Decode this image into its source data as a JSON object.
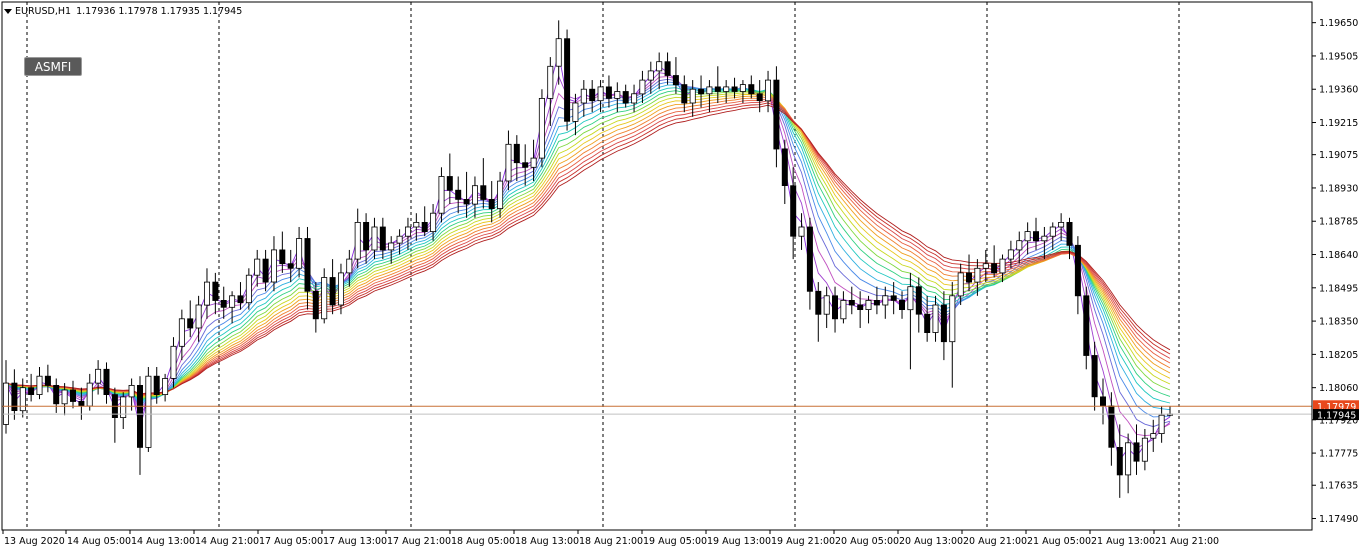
{
  "header": {
    "symbol": "EURUSD,H1",
    "ohlc": [
      "1.17936",
      "1.17978",
      "1.17935",
      "1.17945"
    ]
  },
  "badge": {
    "label": "ASMFI"
  },
  "colors": {
    "bull_body": "#ffffff",
    "bear_body": "#000000",
    "candle_outline": "#000000",
    "grid": "#000000",
    "bid_line": "#c87137",
    "bid_label_bg": "#e8481c",
    "current_label_bg": "#000000",
    "ribbon": [
      "#8a2be2",
      "#a040d0",
      "#c050c0",
      "#6a6ad8",
      "#4a8ae8",
      "#30b0e0",
      "#20c8c0",
      "#30d080",
      "#80d840",
      "#c8d820",
      "#e8c820",
      "#f0a020",
      "#f08030",
      "#e86040",
      "#d84848",
      "#c8302a",
      "#b02020"
    ]
  },
  "chart_data": {
    "type": "candlestick",
    "symbol": "EURUSD",
    "timeframe": "H1",
    "indicator": "ASMFI",
    "y_axis": {
      "ticks": [
        "1.19650",
        "1.19505",
        "1.19360",
        "1.19215",
        "1.19075",
        "1.18930",
        "1.18785",
        "1.18640",
        "1.18495",
        "1.18350",
        "1.18205",
        "1.18060",
        "1.17920",
        "1.17775",
        "1.17635",
        "1.17490"
      ],
      "ylim": [
        1.1744,
        1.1974
      ]
    },
    "x_axis": {
      "ticks": [
        "13 Aug 2020",
        "14 Aug 05:00",
        "14 Aug 13:00",
        "14 Aug 21:00",
        "17 Aug 05:00",
        "17 Aug 13:00",
        "17 Aug 21:00",
        "18 Aug 05:00",
        "18 Aug 13:00",
        "18 Aug 21:00",
        "19 Aug 05:00",
        "19 Aug 13:00",
        "19 Aug 21:00",
        "20 Aug 05:00",
        "20 Aug 13:00",
        "20 Aug 21:00",
        "21 Aug 05:00",
        "21 Aug 13:00",
        "21 Aug 21:00"
      ],
      "period_separators": 7
    },
    "price_labels": {
      "bid": "1.17979",
      "current": "1.17945"
    },
    "bid_price": 1.17979,
    "current_price": 1.17945,
    "candles_ohlc": [
      [
        1.179,
        1.1818,
        1.1786,
        1.1808
      ],
      [
        1.1808,
        1.1814,
        1.1792,
        1.1796
      ],
      [
        1.1796,
        1.181,
        1.1793,
        1.1806
      ],
      [
        1.1806,
        1.1812,
        1.18,
        1.1803
      ],
      [
        1.1803,
        1.1815,
        1.1801,
        1.1811
      ],
      [
        1.1811,
        1.1816,
        1.1804,
        1.1807
      ],
      [
        1.1807,
        1.181,
        1.1795,
        1.1799
      ],
      [
        1.1799,
        1.1808,
        1.1794,
        1.1805
      ],
      [
        1.1805,
        1.1809,
        1.1797,
        1.18
      ],
      [
        1.18,
        1.1806,
        1.1792,
        1.1798
      ],
      [
        1.1798,
        1.1812,
        1.1796,
        1.1808
      ],
      [
        1.1808,
        1.1818,
        1.1803,
        1.1814
      ],
      [
        1.1814,
        1.1817,
        1.1799,
        1.1803
      ],
      [
        1.1803,
        1.1806,
        1.1782,
        1.1793
      ],
      [
        1.1793,
        1.1804,
        1.1788,
        1.1802
      ],
      [
        1.1802,
        1.181,
        1.1796,
        1.1807
      ],
      [
        1.1807,
        1.1811,
        1.1768,
        1.178
      ],
      [
        1.178,
        1.1815,
        1.1778,
        1.1811
      ],
      [
        1.1811,
        1.1815,
        1.1799,
        1.1803
      ],
      [
        1.1803,
        1.1812,
        1.18,
        1.181
      ],
      [
        1.181,
        1.1828,
        1.1806,
        1.1824
      ],
      [
        1.1824,
        1.184,
        1.1818,
        1.1836
      ],
      [
        1.1836,
        1.1844,
        1.1828,
        1.1832
      ],
      [
        1.1832,
        1.1846,
        1.1826,
        1.1842
      ],
      [
        1.1842,
        1.1858,
        1.1836,
        1.1852
      ],
      [
        1.1852,
        1.1856,
        1.1838,
        1.1844
      ],
      [
        1.1844,
        1.185,
        1.1836,
        1.1841
      ],
      [
        1.1841,
        1.1848,
        1.1834,
        1.1846
      ],
      [
        1.1846,
        1.1852,
        1.184,
        1.1843
      ],
      [
        1.1843,
        1.1858,
        1.184,
        1.1855
      ],
      [
        1.1855,
        1.1866,
        1.185,
        1.1862
      ],
      [
        1.1862,
        1.1866,
        1.1848,
        1.1852
      ],
      [
        1.1852,
        1.1872,
        1.1848,
        1.1866
      ],
      [
        1.1866,
        1.1874,
        1.1856,
        1.186
      ],
      [
        1.186,
        1.1866,
        1.1852,
        1.1858
      ],
      [
        1.1858,
        1.1876,
        1.1854,
        1.1871
      ],
      [
        1.1871,
        1.1876,
        1.184,
        1.1848
      ],
      [
        1.1848,
        1.1852,
        1.183,
        1.1836
      ],
      [
        1.1836,
        1.1858,
        1.1834,
        1.1854
      ],
      [
        1.1854,
        1.1862,
        1.1838,
        1.1842
      ],
      [
        1.1842,
        1.186,
        1.1838,
        1.1856
      ],
      [
        1.1856,
        1.1866,
        1.185,
        1.1862
      ],
      [
        1.1862,
        1.1884,
        1.1858,
        1.1878
      ],
      [
        1.1878,
        1.1882,
        1.186,
        1.1866
      ],
      [
        1.1866,
        1.188,
        1.1862,
        1.1876
      ],
      [
        1.1876,
        1.188,
        1.1862,
        1.1866
      ],
      [
        1.1866,
        1.1872,
        1.186,
        1.1869
      ],
      [
        1.1869,
        1.1875,
        1.1864,
        1.1872
      ],
      [
        1.1872,
        1.188,
        1.1866,
        1.1876
      ],
      [
        1.1876,
        1.1882,
        1.187,
        1.1878
      ],
      [
        1.1878,
        1.1885,
        1.1872,
        1.1874
      ],
      [
        1.1874,
        1.1886,
        1.187,
        1.1882
      ],
      [
        1.1882,
        1.1902,
        1.1878,
        1.1898
      ],
      [
        1.1898,
        1.1908,
        1.1886,
        1.1892
      ],
      [
        1.1892,
        1.1898,
        1.1882,
        1.1888
      ],
      [
        1.1888,
        1.19,
        1.188,
        1.1886
      ],
      [
        1.1886,
        1.1898,
        1.188,
        1.1894
      ],
      [
        1.1894,
        1.1906,
        1.1884,
        1.1888
      ],
      [
        1.1888,
        1.1896,
        1.1878,
        1.1884
      ],
      [
        1.1884,
        1.19,
        1.188,
        1.1896
      ],
      [
        1.1896,
        1.1918,
        1.1892,
        1.1912
      ],
      [
        1.1912,
        1.1916,
        1.1896,
        1.1904
      ],
      [
        1.1904,
        1.1912,
        1.1894,
        1.1902
      ],
      [
        1.1902,
        1.1914,
        1.1896,
        1.1906
      ],
      [
        1.1906,
        1.1936,
        1.1902,
        1.1932
      ],
      [
        1.1932,
        1.195,
        1.192,
        1.1946
      ],
      [
        1.1946,
        1.1966,
        1.1938,
        1.1958
      ],
      [
        1.1958,
        1.1962,
        1.1918,
        1.1922
      ],
      [
        1.1922,
        1.1934,
        1.1916,
        1.193
      ],
      [
        1.193,
        1.194,
        1.1924,
        1.1936
      ],
      [
        1.1936,
        1.194,
        1.1926,
        1.1931
      ],
      [
        1.1931,
        1.194,
        1.1926,
        1.1937
      ],
      [
        1.1937,
        1.1942,
        1.1928,
        1.1932
      ],
      [
        1.1932,
        1.1939,
        1.1926,
        1.1935
      ],
      [
        1.1935,
        1.1938,
        1.1928,
        1.193
      ],
      [
        1.193,
        1.1938,
        1.1926,
        1.1934
      ],
      [
        1.1934,
        1.1944,
        1.193,
        1.194
      ],
      [
        1.194,
        1.1948,
        1.1934,
        1.1944
      ],
      [
        1.1944,
        1.1952,
        1.1936,
        1.1948
      ],
      [
        1.1948,
        1.1952,
        1.1938,
        1.1942
      ],
      [
        1.1942,
        1.195,
        1.1934,
        1.1938
      ],
      [
        1.1938,
        1.1942,
        1.1926,
        1.193
      ],
      [
        1.193,
        1.194,
        1.1924,
        1.1936
      ],
      [
        1.1936,
        1.1942,
        1.1928,
        1.1934
      ],
      [
        1.1934,
        1.194,
        1.1926,
        1.1937
      ],
      [
        1.1937,
        1.1946,
        1.193,
        1.1935
      ],
      [
        1.1935,
        1.194,
        1.193,
        1.1937
      ],
      [
        1.1937,
        1.1941,
        1.1932,
        1.1935
      ],
      [
        1.1935,
        1.194,
        1.193,
        1.1938
      ],
      [
        1.1938,
        1.1942,
        1.1932,
        1.1934
      ],
      [
        1.1934,
        1.194,
        1.1926,
        1.1931
      ],
      [
        1.1931,
        1.1944,
        1.1926,
        1.194
      ],
      [
        1.194,
        1.1946,
        1.1902,
        1.191
      ],
      [
        1.191,
        1.1914,
        1.1886,
        1.1894
      ],
      [
        1.1894,
        1.1902,
        1.1862,
        1.1872
      ],
      [
        1.1872,
        1.1882,
        1.1866,
        1.1876
      ],
      [
        1.1876,
        1.188,
        1.184,
        1.1848
      ],
      [
        1.1848,
        1.1852,
        1.1826,
        1.1838
      ],
      [
        1.1838,
        1.185,
        1.1832,
        1.1846
      ],
      [
        1.1846,
        1.185,
        1.183,
        1.1836
      ],
      [
        1.1836,
        1.1848,
        1.1834,
        1.1844
      ],
      [
        1.1844,
        1.185,
        1.1838,
        1.1842
      ],
      [
        1.1842,
        1.1848,
        1.1832,
        1.184
      ],
      [
        1.184,
        1.1846,
        1.1834,
        1.1844
      ],
      [
        1.1844,
        1.185,
        1.1838,
        1.1842
      ],
      [
        1.1842,
        1.185,
        1.1836,
        1.1846
      ],
      [
        1.1846,
        1.1852,
        1.1838,
        1.1844
      ],
      [
        1.1844,
        1.1848,
        1.1836,
        1.184
      ],
      [
        1.184,
        1.1856,
        1.1814,
        1.185
      ],
      [
        1.185,
        1.1854,
        1.183,
        1.1838
      ],
      [
        1.1838,
        1.1846,
        1.1826,
        1.183
      ],
      [
        1.183,
        1.1846,
        1.1826,
        1.1842
      ],
      [
        1.1842,
        1.1848,
        1.1818,
        1.1826
      ],
      [
        1.1826,
        1.1852,
        1.1806,
        1.1846
      ],
      [
        1.1846,
        1.186,
        1.1842,
        1.1856
      ],
      [
        1.1856,
        1.1864,
        1.1848,
        1.1852
      ],
      [
        1.1852,
        1.1862,
        1.1846,
        1.1858
      ],
      [
        1.1858,
        1.1866,
        1.1852,
        1.186
      ],
      [
        1.186,
        1.1868,
        1.1854,
        1.1856
      ],
      [
        1.1856,
        1.1864,
        1.1852,
        1.1862
      ],
      [
        1.1862,
        1.187,
        1.1858,
        1.1866
      ],
      [
        1.1866,
        1.1874,
        1.186,
        1.187
      ],
      [
        1.187,
        1.1878,
        1.1864,
        1.1874
      ],
      [
        1.1874,
        1.188,
        1.1866,
        1.187
      ],
      [
        1.187,
        1.1876,
        1.1862,
        1.1872
      ],
      [
        1.1872,
        1.1878,
        1.1866,
        1.1876
      ],
      [
        1.1876,
        1.1882,
        1.187,
        1.1878
      ],
      [
        1.1878,
        1.188,
        1.1862,
        1.1868
      ],
      [
        1.1868,
        1.1872,
        1.1838,
        1.1846
      ],
      [
        1.1846,
        1.185,
        1.1814,
        1.182
      ],
      [
        1.182,
        1.1826,
        1.1796,
        1.1802
      ],
      [
        1.1802,
        1.181,
        1.179,
        1.1798
      ],
      [
        1.1798,
        1.1804,
        1.1772,
        1.178
      ],
      [
        1.178,
        1.179,
        1.1758,
        1.1768
      ],
      [
        1.1768,
        1.1786,
        1.176,
        1.1782
      ],
      [
        1.1782,
        1.179,
        1.1768,
        1.1774
      ],
      [
        1.1774,
        1.1788,
        1.177,
        1.1784
      ],
      [
        1.1784,
        1.1792,
        1.1778,
        1.1786
      ],
      [
        1.1786,
        1.1798,
        1.1782,
        1.1794
      ],
      [
        1.1794,
        1.1798,
        1.17935,
        1.17945
      ]
    ],
    "ribbon": {
      "description": "ASMFI moving-average ribbon with 17 color bands",
      "bands": 17
    }
  }
}
